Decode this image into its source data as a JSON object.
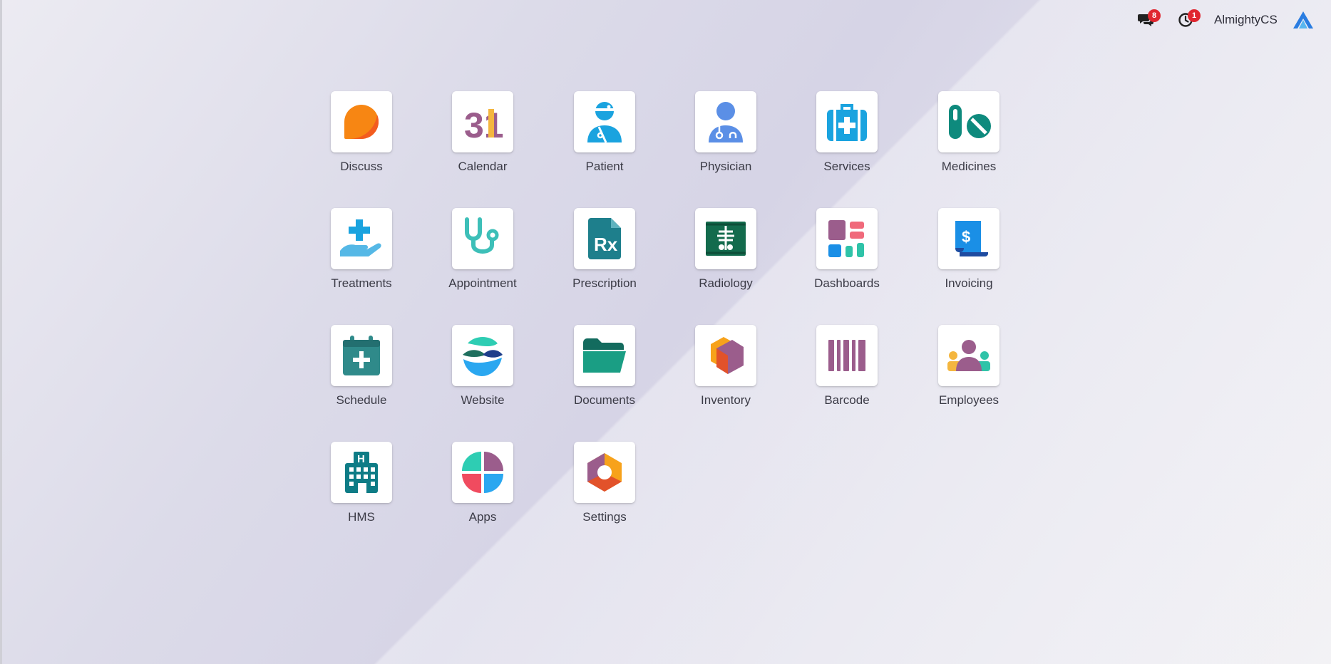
{
  "topbar": {
    "messages_count": "8",
    "activities_count": "1",
    "username": "AlmightyCS"
  },
  "apps": [
    {
      "label": "Discuss",
      "icon": "discuss-icon"
    },
    {
      "label": "Calendar",
      "icon": "calendar-icon",
      "icon_text": "31"
    },
    {
      "label": "Patient",
      "icon": "patient-icon"
    },
    {
      "label": "Physician",
      "icon": "physician-icon"
    },
    {
      "label": "Services",
      "icon": "medical-kit-icon"
    },
    {
      "label": "Medicines",
      "icon": "pills-icon"
    },
    {
      "label": "Treatments",
      "icon": "hand-cross-icon"
    },
    {
      "label": "Appointment",
      "icon": "stethoscope-icon"
    },
    {
      "label": "Prescription",
      "icon": "rx-document-icon",
      "icon_text": "Rx"
    },
    {
      "label": "Radiology",
      "icon": "xray-icon"
    },
    {
      "label": "Dashboards",
      "icon": "dashboard-icon"
    },
    {
      "label": "Invoicing",
      "icon": "invoice-icon",
      "icon_text": "$"
    },
    {
      "label": "Schedule",
      "icon": "calendar-plus-icon"
    },
    {
      "label": "Website",
      "icon": "website-icon"
    },
    {
      "label": "Documents",
      "icon": "folder-icon"
    },
    {
      "label": "Inventory",
      "icon": "box-icon"
    },
    {
      "label": "Barcode",
      "icon": "barcode-icon"
    },
    {
      "label": "Employees",
      "icon": "employees-icon"
    },
    {
      "label": "HMS",
      "icon": "hospital-icon",
      "icon_text": "H"
    },
    {
      "label": "Apps",
      "icon": "apps-icon"
    },
    {
      "label": "Settings",
      "icon": "settings-icon"
    }
  ]
}
